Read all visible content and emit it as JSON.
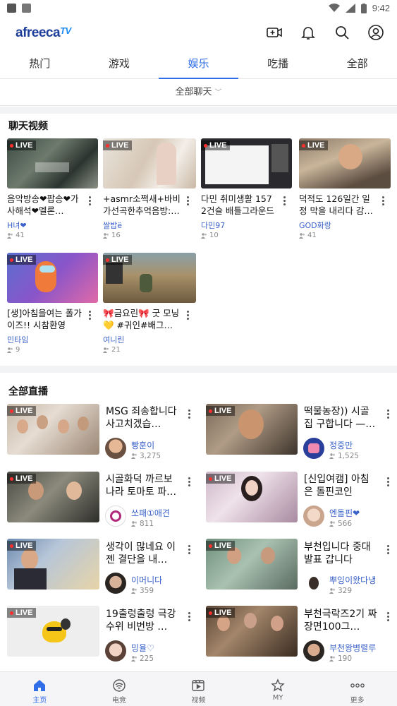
{
  "status_bar": {
    "time": "9:42"
  },
  "header": {
    "logo_main": "afreeca",
    "logo_tv": "TV"
  },
  "tabs": [
    {
      "label": "热门",
      "active": false
    },
    {
      "label": "游戏",
      "active": false
    },
    {
      "label": "娱乐",
      "active": true
    },
    {
      "label": "吃播",
      "active": false
    },
    {
      "label": "全部",
      "active": false
    }
  ],
  "filter": {
    "label": "全部聊天"
  },
  "chat_section": {
    "title": "聊天视频",
    "live_label": "LIVE",
    "items": [
      {
        "title": "음악방송❤팝송❤가사해석❤멜론…",
        "user": "H녀❤",
        "viewers": "41"
      },
      {
        "title": "+asmr소쩍새+바비가선곡한추억음방:…",
        "user": "쌀밥ë",
        "viewers": "16"
      },
      {
        "title": "다민 취미생활 157 2건슬 배틀그라운드",
        "user": "다민97",
        "viewers": "10"
      },
      {
        "title": "덕적도 126일간 일정 막을 내리다 감…",
        "user": "GOD화랑",
        "viewers": "41"
      },
      {
        "title": "[생]아침을여는 폴가이즈!! 시참환영",
        "user": "민타임",
        "viewers": "9"
      },
      {
        "title": "🎀금요린🎀 굿 모닝 💛 #귀인#배그…",
        "user": "여니린",
        "viewers": "21"
      }
    ]
  },
  "all_section": {
    "title": "全部直播",
    "live_label": "LIVE",
    "items": [
      {
        "title": "MSG 죄송합니다 사고치겠습…",
        "user": "빵훈이",
        "viewers": "3,275"
      },
      {
        "title": "떡물농장)) 시골집 구합니다 —…",
        "user": "정중만",
        "viewers": "1,525"
      },
      {
        "title": "시골화덕 까르보나라 토마토 파…",
        "user": "쏘패①애견",
        "viewers": "811"
      },
      {
        "title": "[신입여캠] 아침은 돌핀코인",
        "user": "엔돌핀❤",
        "viewers": "566"
      },
      {
        "title": "생각이 많네요 이젠 결단을 내…",
        "user": "이머니다",
        "viewers": "359"
      },
      {
        "title": "부천입니다 중대발표 갑니다",
        "user": "뿌잉이왔다냉",
        "viewers": "329"
      },
      {
        "title": "19출렁출렁 극강수위 비번방 …",
        "user": "밍율♡",
        "viewers": "225"
      },
      {
        "title": "부천극락즈2기 짜장면100그…",
        "user": "부천왕병렬루",
        "viewers": "190"
      }
    ]
  },
  "bottom_nav": [
    {
      "label": "主页",
      "icon": "home-icon",
      "active": true
    },
    {
      "label": "电竞",
      "icon": "esports-icon",
      "active": false
    },
    {
      "label": "视频",
      "icon": "video-icon",
      "active": false
    },
    {
      "label": "MY",
      "icon": "star-icon",
      "active": false
    },
    {
      "label": "更多",
      "icon": "more-dots-icon",
      "active": false
    }
  ],
  "colors": {
    "accent": "#2f6ee8",
    "brand": "#1c3d99",
    "username": "#3b62c9"
  }
}
